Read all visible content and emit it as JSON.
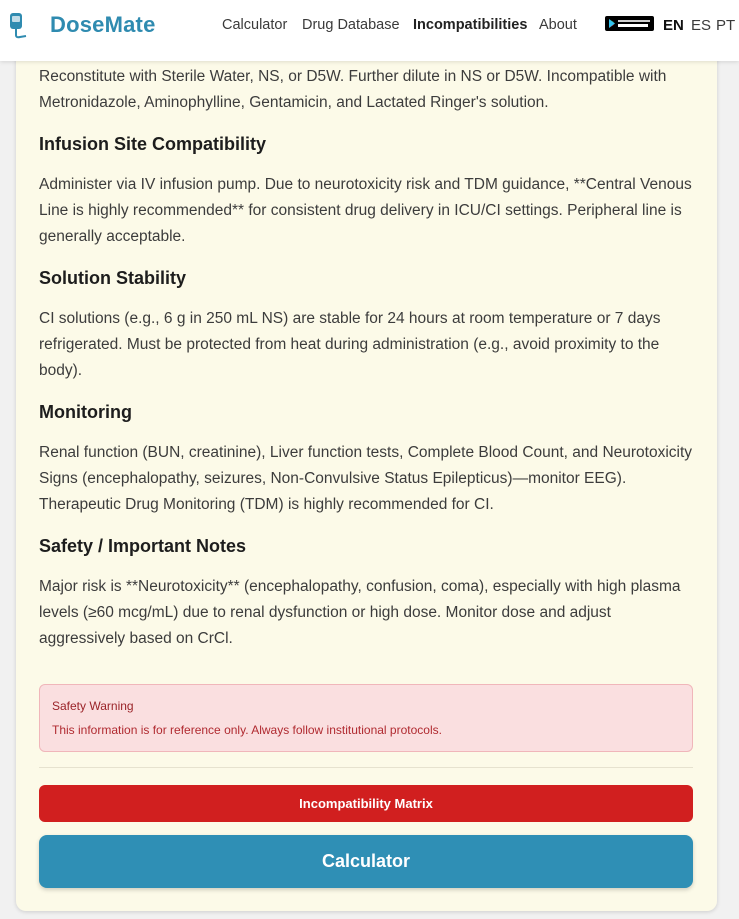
{
  "header": {
    "brand": "DoseMate",
    "nav": [
      {
        "label": "Calculator",
        "active": false
      },
      {
        "label": "Drug Database",
        "active": false
      },
      {
        "label": "Incompatibilities",
        "active": true
      },
      {
        "label": "About",
        "active": false
      }
    ],
    "store_badge_icon": "google-play-badge",
    "languages": [
      "EN",
      "ES",
      "PT"
    ],
    "active_language": "EN"
  },
  "content": {
    "intro": "Reconstitute with Sterile Water, NS, or D5W. Further dilute in NS or D5W. Incompatible with Metronidazole, Aminophylline, Gentamicin, and Lactated Ringer's solution.",
    "sections": [
      {
        "title": "Infusion Site Compatibility",
        "text": "Administer via IV infusion pump. Due to neurotoxicity risk and TDM guidance, **Central Venous Line is highly recommended** for consistent drug delivery in ICU/CI settings. Peripheral line is generally acceptable."
      },
      {
        "title": "Solution Stability",
        "text": "CI solutions (e.g., 6 g in 250 mL NS) are stable for 24 hours at room temperature or 7 days refrigerated. Must be protected from heat during administration (e.g., avoid proximity to the body)."
      },
      {
        "title": "Monitoring",
        "text": "Renal function (BUN, creatinine), Liver function tests, Complete Blood Count, and Neurotoxicity Signs (encephalopathy, seizures, Non-Convulsive Status Epilepticus)—monitor EEG). Therapeutic Drug Monitoring (TDM) is highly recommended for CI."
      },
      {
        "title": "Safety / Important Notes",
        "text": "Major risk is **Neurotoxicity** (encephalopathy, confusion, coma), especially with high plasma levels (≥60 mcg/mL) due to renal dysfunction or high dose. Monitor dose and adjust aggressively based on CrCl."
      }
    ]
  },
  "warning": {
    "title": "Safety Warning",
    "text": "This information is for reference only. Always follow institutional protocols."
  },
  "buttons": {
    "incompatibility": "Incompatibility Matrix",
    "calculator": "Calculator"
  },
  "colors": {
    "brand": "#2f8bb0",
    "card_bg": "#fcfae8",
    "danger": "#d11f1f",
    "primary": "#2f8fb5",
    "warning_bg": "#fadfe0"
  }
}
